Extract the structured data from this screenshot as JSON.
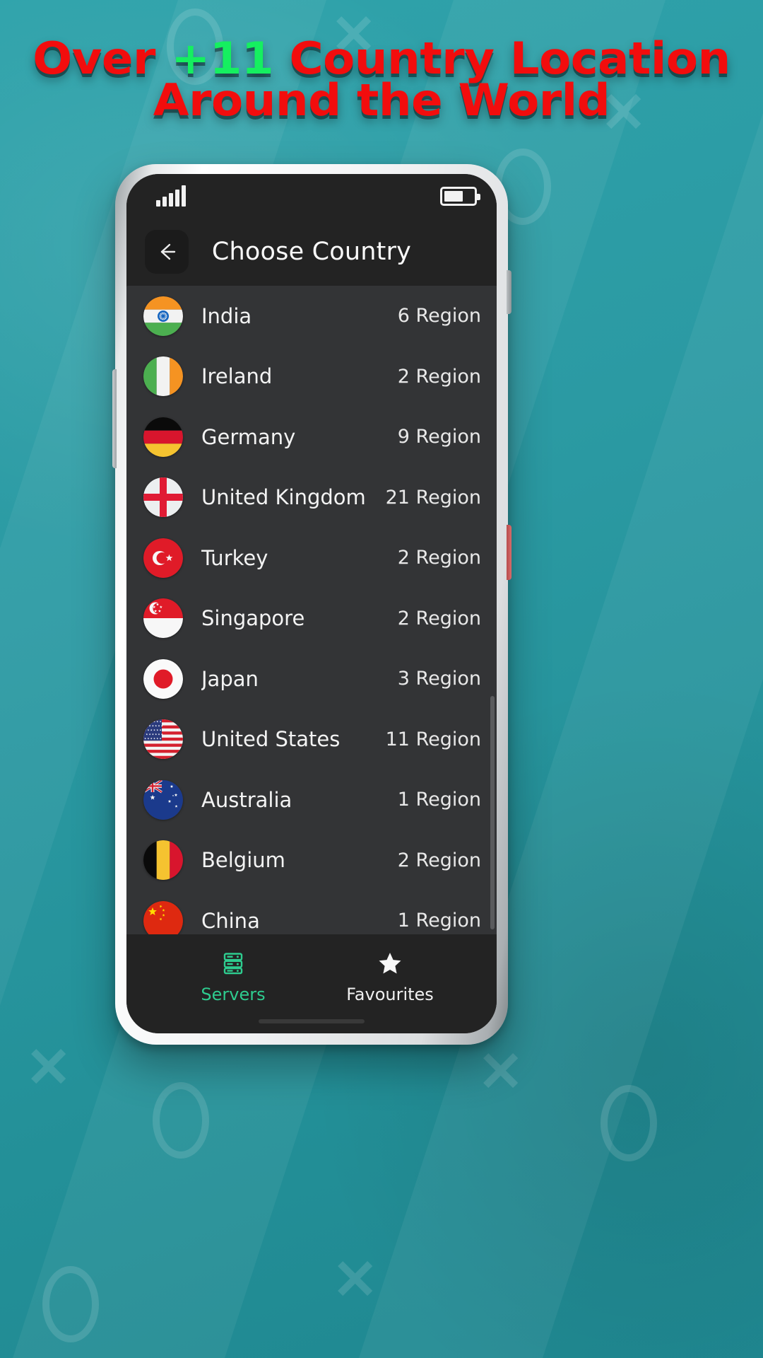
{
  "promo": {
    "line1_prefix": "Over ",
    "line1_accent": "+11",
    "line1_suffix": " Country Location",
    "line2": "Around the World",
    "text_color": "#f20d0d",
    "accent_color": "#15ef60",
    "background_color": "#2b9aa3"
  },
  "statusbar": {
    "signal_icon": "signal-bars-icon",
    "battery_icon": "battery-icon",
    "battery_level_percent": 66
  },
  "appbar": {
    "back_icon": "arrow-left-icon",
    "title": "Choose Country"
  },
  "list": {
    "region_suffix": "Region",
    "countries": [
      {
        "name": "India",
        "regions": 6,
        "region_label": "6 Region",
        "flag": "flag-india-icon"
      },
      {
        "name": "Ireland",
        "regions": 2,
        "region_label": "2 Region",
        "flag": "flag-ireland-icon"
      },
      {
        "name": "Germany",
        "regions": 9,
        "region_label": "9 Region",
        "flag": "flag-germany-icon"
      },
      {
        "name": "United Kingdom",
        "regions": 21,
        "region_label": "21 Region",
        "flag": "flag-united-kingdom-icon"
      },
      {
        "name": "Turkey",
        "regions": 2,
        "region_label": "2 Region",
        "flag": "flag-turkey-icon"
      },
      {
        "name": "Singapore",
        "regions": 2,
        "region_label": "2 Region",
        "flag": "flag-singapore-icon"
      },
      {
        "name": "Japan",
        "regions": 3,
        "region_label": "3 Region",
        "flag": "flag-japan-icon"
      },
      {
        "name": "United States",
        "regions": 11,
        "region_label": "11 Region",
        "flag": "flag-united-states-icon"
      },
      {
        "name": "Australia",
        "regions": 1,
        "region_label": "1 Region",
        "flag": "flag-australia-icon"
      },
      {
        "name": "Belgium",
        "regions": 2,
        "region_label": "2 Region",
        "flag": "flag-belgium-icon"
      },
      {
        "name": "China",
        "regions": 1,
        "region_label": "1 Region",
        "flag": "flag-china-icon"
      }
    ]
  },
  "bottomnav": {
    "items": [
      {
        "label": "Servers",
        "icon": "servers-icon",
        "active": true,
        "color": "#2ecc8f"
      },
      {
        "label": "Favourites",
        "icon": "star-icon",
        "active": false,
        "color": "#f0f0f0"
      }
    ]
  },
  "theme": {
    "screen_background": "#232323",
    "list_background": "#333436",
    "accent": "#2ecc8f"
  }
}
